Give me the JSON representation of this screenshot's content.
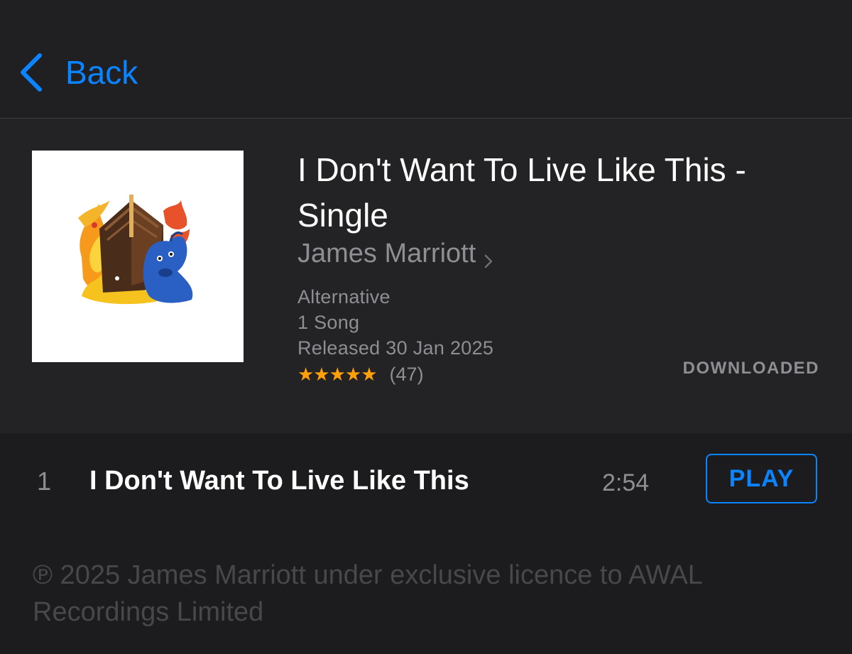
{
  "nav": {
    "back_label": "Back",
    "accent_color": "#0a84ff"
  },
  "album": {
    "title": "I Don't Want To Live Like This - Single",
    "artist": "James Marriott",
    "genre": "Alternative",
    "song_count": "1 Song",
    "released": "Released 30 Jan 2025",
    "rating_stars": 5,
    "rating_count": "(47)",
    "status": "DOWNLOADED",
    "artwork_icon": "album-artwork-boat-fire-dog"
  },
  "tracks": [
    {
      "number": "1",
      "title": "I Don't Want To Live Like This",
      "duration": "2:54",
      "action_label": "PLAY"
    }
  ],
  "footer": {
    "copyright": "℗ 2025 James Marriott under exclusive licence to AWAL Recordings Limited"
  }
}
